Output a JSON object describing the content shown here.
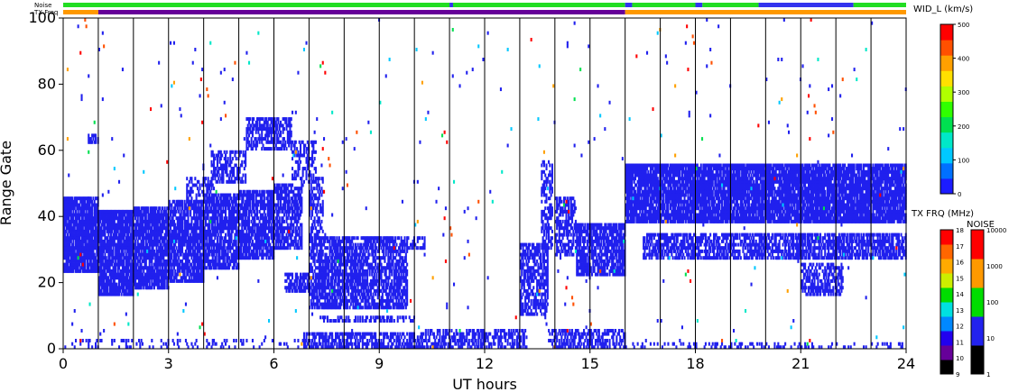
{
  "chart_data": {
    "type": "heatmap",
    "title": "",
    "xlabel": "UT hours",
    "ylabel": "Range Gate",
    "xlim": [
      0,
      24
    ],
    "ylim": [
      0,
      100
    ],
    "x_ticks": [
      "0",
      "3",
      "6",
      "9",
      "12",
      "15",
      "18",
      "21",
      "24"
    ],
    "x_tick_values": [
      0,
      3,
      6,
      9,
      12,
      15,
      18,
      21,
      24
    ],
    "y_ticks": [
      "0",
      "20",
      "40",
      "60",
      "80",
      "100"
    ],
    "y_tick_values": [
      0,
      20,
      40,
      60,
      80,
      100
    ],
    "hour_lines": [
      1,
      2,
      3,
      4,
      5,
      6,
      7,
      8,
      9,
      10,
      11,
      12,
      13,
      14,
      15,
      16,
      17,
      18,
      19,
      20,
      21,
      22,
      23
    ],
    "grid": false,
    "status_bars": {
      "noise_label": "Noise",
      "txfreq_label": "TX Freq",
      "noise_bar": [
        {
          "x0": 0,
          "x1": 11.0,
          "color": "#22dd22"
        },
        {
          "x0": 11.0,
          "x1": 11.1,
          "color": "#3333ee"
        },
        {
          "x0": 11.1,
          "x1": 16.0,
          "color": "#22dd22"
        },
        {
          "x0": 16.0,
          "x1": 16.2,
          "color": "#3333ee"
        },
        {
          "x0": 16.2,
          "x1": 18.0,
          "color": "#22dd22"
        },
        {
          "x0": 18.0,
          "x1": 18.2,
          "color": "#3333ee"
        },
        {
          "x0": 18.2,
          "x1": 19.8,
          "color": "#22dd22"
        },
        {
          "x0": 19.8,
          "x1": 22.5,
          "color": "#3333ee"
        },
        {
          "x0": 22.5,
          "x1": 24.0,
          "color": "#22dd22"
        }
      ],
      "txfreq_bar": [
        {
          "x0": 0,
          "x1": 1.0,
          "color": "#ff9900"
        },
        {
          "x0": 1.0,
          "x1": 16.0,
          "color": "#660099"
        },
        {
          "x0": 16.0,
          "x1": 24.0,
          "color": "#ff9900"
        }
      ]
    },
    "colorbars": [
      {
        "title": "WID_L (km/s)",
        "tick_labels": [
          "0",
          "100",
          "200",
          "300",
          "400",
          "500"
        ],
        "tick_values": [
          0,
          100,
          200,
          300,
          400,
          500
        ],
        "range": [
          0,
          500
        ],
        "colors": [
          "#1c1cff",
          "#0070ff",
          "#00c8ff",
          "#00e8c8",
          "#00e050",
          "#30ff00",
          "#b0ff00",
          "#ffe000",
          "#ffa000",
          "#ff5000",
          "#ff0000"
        ]
      },
      {
        "title": "TX FRQ (MHz)",
        "tick_labels": [
          "9",
          "10",
          "11",
          "12",
          "13",
          "14",
          "15",
          "16",
          "17",
          "18"
        ],
        "tick_values": [
          9,
          10,
          11,
          12,
          13,
          14,
          15,
          16,
          17,
          18
        ],
        "colors": [
          "#000000",
          "#660099",
          "#2200ee",
          "#0088ff",
          "#00e0e0",
          "#00dd00",
          "#ccee00",
          "#ffaa00",
          "#ff6600",
          "#ff0000"
        ]
      },
      {
        "title": "NOISE",
        "tick_labels": [
          "1",
          "10",
          "100",
          "1000",
          "10000"
        ],
        "tick_values": [
          1,
          10,
          100,
          1000,
          10000
        ],
        "colors": [
          "#000000",
          "#2222ee",
          "#00dd00",
          "#ff9900",
          "#ff0000"
        ]
      }
    ],
    "scatter_color": "#2020ee",
    "regions": [
      {
        "x0": 0.0,
        "x1": 1.0,
        "y0": 23,
        "y1": 46,
        "density": 0.9
      },
      {
        "x0": 0.6,
        "x1": 1.0,
        "y0": 62,
        "y1": 65,
        "density": 0.5
      },
      {
        "x0": 1.0,
        "x1": 2.0,
        "y0": 16,
        "y1": 42,
        "density": 0.88
      },
      {
        "x0": 2.0,
        "x1": 3.0,
        "y0": 18,
        "y1": 43,
        "density": 0.85
      },
      {
        "x0": 3.0,
        "x1": 4.0,
        "y0": 20,
        "y1": 45,
        "density": 0.82
      },
      {
        "x0": 4.0,
        "x1": 5.0,
        "y0": 24,
        "y1": 47,
        "density": 0.8
      },
      {
        "x0": 5.0,
        "x1": 6.0,
        "y0": 27,
        "y1": 48,
        "density": 0.75
      },
      {
        "x0": 6.0,
        "x1": 6.8,
        "y0": 30,
        "y1": 50,
        "density": 0.7
      },
      {
        "x0": 3.5,
        "x1": 4.3,
        "y0": 44,
        "y1": 52,
        "density": 0.5
      },
      {
        "x0": 4.2,
        "x1": 5.2,
        "y0": 50,
        "y1": 60,
        "density": 0.55
      },
      {
        "x0": 5.2,
        "x1": 6.5,
        "y0": 60,
        "y1": 70,
        "density": 0.55
      },
      {
        "x0": 6.5,
        "x1": 7.2,
        "y0": 50,
        "y1": 63,
        "density": 0.45
      },
      {
        "x0": 7.0,
        "x1": 7.4,
        "y0": 32,
        "y1": 52,
        "density": 0.45
      },
      {
        "x0": 6.3,
        "x1": 7.0,
        "y0": 17,
        "y1": 23,
        "density": 0.6
      },
      {
        "x0": 7.0,
        "x1": 9.8,
        "y0": 12,
        "y1": 34,
        "density": 0.7
      },
      {
        "x0": 9.8,
        "x1": 10.3,
        "y0": 30,
        "y1": 34,
        "density": 0.5
      },
      {
        "x0": 6.8,
        "x1": 10.3,
        "y0": 0,
        "y1": 5,
        "density": 0.6
      },
      {
        "x0": 7.3,
        "x1": 10.0,
        "y0": 8,
        "y1": 10,
        "density": 0.45
      },
      {
        "x0": 10.3,
        "x1": 13.2,
        "y0": 0,
        "y1": 6,
        "density": 0.55
      },
      {
        "x0": 13.0,
        "x1": 13.8,
        "y0": 10,
        "y1": 32,
        "density": 0.6
      },
      {
        "x0": 13.6,
        "x1": 13.95,
        "y0": 30,
        "y1": 57,
        "density": 0.45
      },
      {
        "x0": 14.0,
        "x1": 14.6,
        "y0": 28,
        "y1": 46,
        "density": 0.6
      },
      {
        "x0": 14.6,
        "x1": 16.0,
        "y0": 22,
        "y1": 38,
        "density": 0.75
      },
      {
        "x0": 13.8,
        "x1": 16.0,
        "y0": 0,
        "y1": 6,
        "density": 0.55
      },
      {
        "x0": 16.0,
        "x1": 24.0,
        "y0": 38,
        "y1": 56,
        "density": 0.88
      },
      {
        "x0": 16.5,
        "x1": 24.0,
        "y0": 27,
        "y1": 35,
        "density": 0.65
      },
      {
        "x0": 21.0,
        "x1": 22.2,
        "y0": 16,
        "y1": 26,
        "density": 0.6
      },
      {
        "x0": 16.0,
        "x1": 24.0,
        "y0": 0,
        "y1": 2,
        "density": 0.25
      },
      {
        "x0": 0.0,
        "x1": 7.0,
        "y0": 0,
        "y1": 3,
        "density": 0.15
      },
      {
        "x0": 0.0,
        "x1": 24.0,
        "y0": 0,
        "y1": 100,
        "density": 0.006
      }
    ],
    "noise_speckle_colors": [
      "#ff0000",
      "#ff5000",
      "#00e050",
      "#00c8ff",
      "#ffa000",
      "#00e8c8"
    ]
  }
}
